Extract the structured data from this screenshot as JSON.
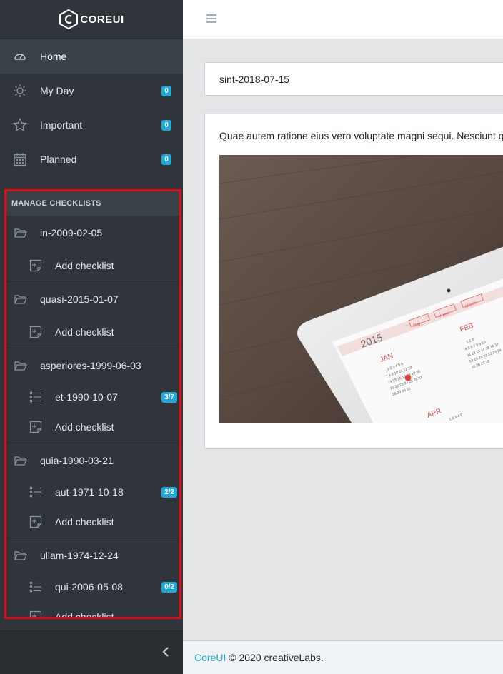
{
  "brand": {
    "name": "COREUI"
  },
  "nav": [
    {
      "label": "Home",
      "icon": "speedometer-icon",
      "active": true
    },
    {
      "label": "My Day",
      "icon": "sun-icon",
      "badge": "0"
    },
    {
      "label": "Important",
      "icon": "star-icon",
      "badge": "0"
    },
    {
      "label": "Planned",
      "icon": "calendar-icon",
      "badge": "0"
    }
  ],
  "checklists": {
    "title": "MANAGE CHECKLISTS",
    "add_label": "Add checklist",
    "groups": [
      {
        "name": "in-2009-02-05",
        "items": []
      },
      {
        "name": "quasi-2015-01-07",
        "items": []
      },
      {
        "name": "asperiores-1999-06-03",
        "items": [
          {
            "name": "et-1990-10-07",
            "badge": "3/7"
          }
        ]
      },
      {
        "name": "quia-1990-03-21",
        "items": [
          {
            "name": "aut-1971-10-18",
            "badge": "2/2"
          }
        ]
      },
      {
        "name": "ullam-1974-12-24",
        "items": [
          {
            "name": "qui-2006-05-08",
            "badge": "0/2"
          }
        ]
      }
    ]
  },
  "main": {
    "card_title": "sint-2018-07-15",
    "description": "Quae autem ratione eius vero voluptate magni sequi. Nesciunt quia",
    "photo_text": {
      "year": "2015",
      "months": [
        "JAN",
        "FEB",
        "APR"
      ],
      "tabs": [
        "Day",
        "Week",
        "Month"
      ]
    }
  },
  "footer": {
    "brand_link": "CoreUI",
    "text": "© 2020 creativeLabs."
  },
  "colors": {
    "accent": "#20a8d8",
    "sidebar": "#2f353a",
    "highlight_border": "#e20b18"
  }
}
